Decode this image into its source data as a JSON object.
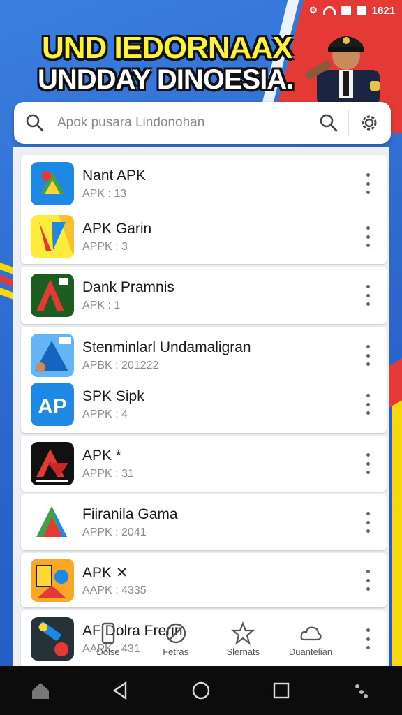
{
  "status_bar": {
    "time": "1821"
  },
  "banner": {
    "line1": "UND IEDORNAAX",
    "line2": "UNDDAY DINOESIA."
  },
  "search": {
    "placeholder": "Apok pusara Lindonohan",
    "search_icon": "search-icon",
    "settings_icon": "gear-icon"
  },
  "apps": [
    {
      "title": "Nant APK",
      "sub": "APK : 13"
    },
    {
      "title": "APK Garin",
      "sub": "APPK : 3"
    },
    {
      "title": "Dank Pramnis",
      "sub": "APK : 1"
    },
    {
      "title": "Stenminlarl Undamaligran",
      "sub": "APBK : 201222"
    },
    {
      "title": "SPK Sipk",
      "sub": "APPK : 4"
    },
    {
      "title": "APK *",
      "sub": "APPK : 31"
    },
    {
      "title": "Fiiranila Gama",
      "sub": "APPK : 2041"
    },
    {
      "title": "APK ✕",
      "sub": "AAPK : 4335"
    },
    {
      "title": "AF Dolra Frerin",
      "sub": "AAPK : 431"
    }
  ],
  "bottom_tabs": [
    {
      "label": "Dolse",
      "icon": "phone-icon"
    },
    {
      "label": "Fetras",
      "icon": "no-icon"
    },
    {
      "label": "Slernats",
      "icon": "star-icon"
    },
    {
      "label": "Duantelian",
      "icon": "cloud-icon"
    }
  ],
  "nav": [
    "home-icon",
    "back-icon",
    "home-circle-icon",
    "recents-icon",
    "assist-icon"
  ],
  "colors": {
    "banner_yellow": "#fff23a",
    "bg_blue": "#2f6fd6",
    "accent_red": "#e53935"
  }
}
